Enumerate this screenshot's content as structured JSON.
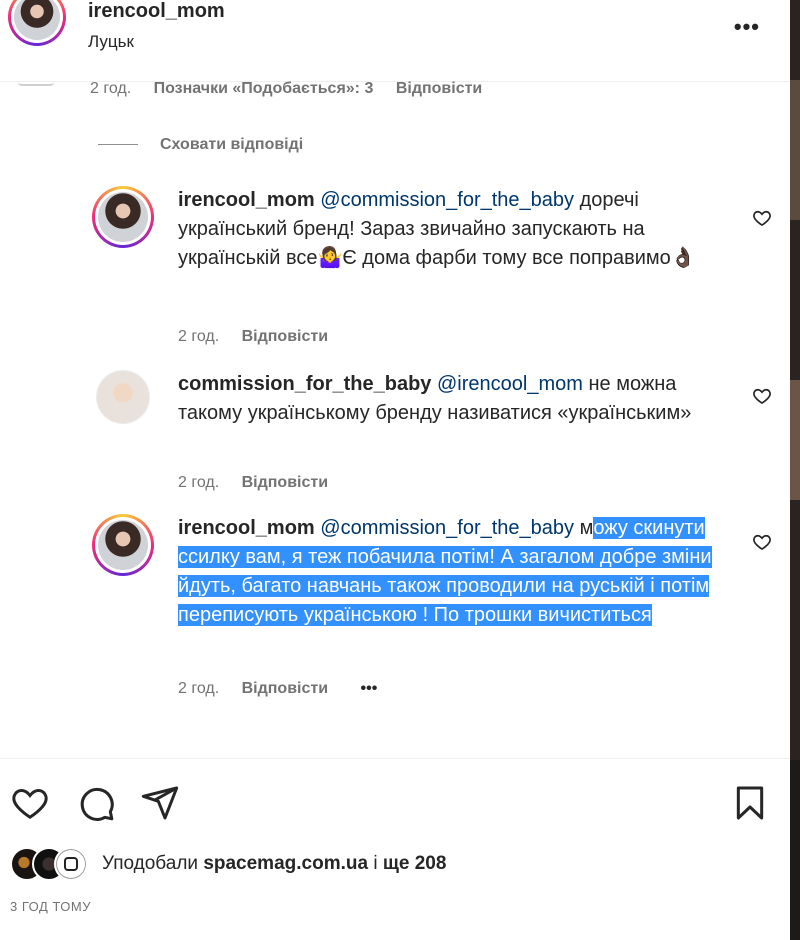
{
  "header": {
    "username": "irencool_mom",
    "location": "Луцьк",
    "more_label": "•••"
  },
  "top_meta": {
    "time": "2 год.",
    "likes": "Позначки «Подобається»: 3",
    "reply": "Відповісти"
  },
  "hide_replies_label": "Сховати відповіді",
  "replies": [
    {
      "username": "irencool_mom",
      "mention": "@commission_for_the_baby",
      "text": " доречі український бренд! Зараз звичайно запускають на українській все🤷‍♀️Є дома фарби тому все поправимо👌🏿",
      "time": "2 год.",
      "reply": "Відповісти"
    },
    {
      "username": "commission_for_the_baby",
      "mention": "@irencool_mom",
      "text": " не можна такому українському бренду називатися «українським»",
      "time": "2 год.",
      "reply": "Відповісти"
    },
    {
      "username": "irencool_mom",
      "mention": "@commission_for_the_baby",
      "text_plain": " м",
      "text_selected": "ожу скинути ссилку вам, я теж побачила потім! А загалом добре зміни йдуть, багато навчань також проводили на руській і потім переписують українською ! По трошки вичиститься",
      "time": "2 год.",
      "reply": "Відповісти",
      "more": "•••"
    }
  ],
  "likes_line": {
    "prefix": "Уподобали ",
    "user": "spacemag.com.ua",
    "middle": " і ",
    "others": "ще 208"
  },
  "time_ago": "3 ГОД ТОМУ",
  "icons": [
    "heart-icon",
    "comment-icon",
    "share-icon",
    "bookmark-icon",
    "more-icon"
  ],
  "colors": {
    "mention": "#00376b",
    "selection": "#3390ff",
    "meta": "#737373"
  }
}
